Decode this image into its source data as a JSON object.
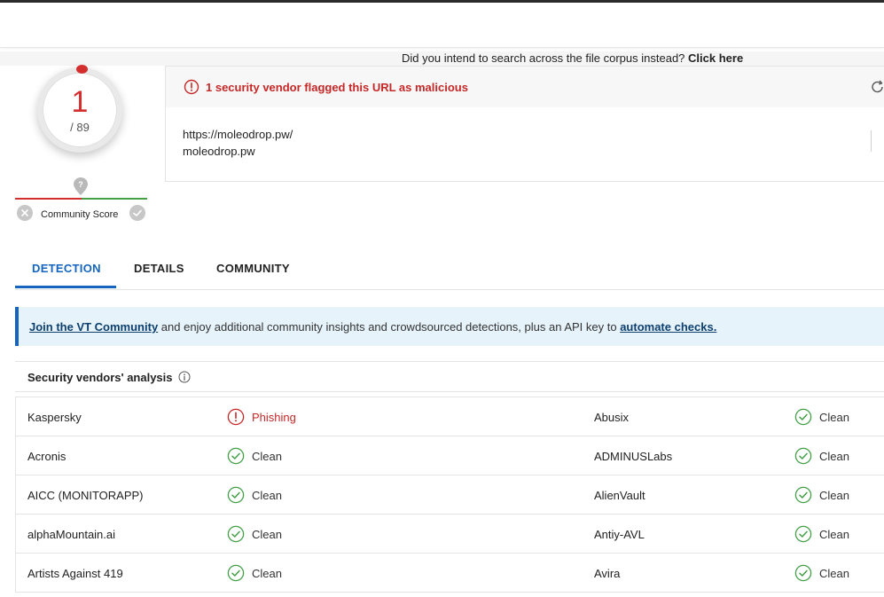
{
  "corpus_hint": {
    "text": "Did you intend to search across the file corpus instead?",
    "link": "Click here"
  },
  "score": {
    "detections": "1",
    "total": "/ 89",
    "color": "#d32f2f"
  },
  "community_score": {
    "label": "Community Score"
  },
  "flag_card": {
    "message": "1 security vendor flagged this URL as malicious",
    "url": "https://moleodrop.pw/",
    "domain": "moleodrop.pw"
  },
  "tabs": [
    {
      "label": "DETECTION",
      "active": true
    },
    {
      "label": "DETAILS",
      "active": false
    },
    {
      "label": "COMMUNITY",
      "active": false
    }
  ],
  "banner": {
    "link1": "Join the VT Community",
    "middle": " and enjoy additional community insights and crowdsourced detections, plus an API key to ",
    "link2": "automate checks."
  },
  "analysis": {
    "title": "Security vendors' analysis"
  },
  "vendors": [
    {
      "left": {
        "name": "Kaspersky",
        "result": "Phishing",
        "status": "malicious"
      },
      "right": {
        "name": "Abusix",
        "result": "Clean",
        "status": "clean"
      }
    },
    {
      "left": {
        "name": "Acronis",
        "result": "Clean",
        "status": "clean"
      },
      "right": {
        "name": "ADMINUSLabs",
        "result": "Clean",
        "status": "clean"
      }
    },
    {
      "left": {
        "name": "AICC (MONITORAPP)",
        "result": "Clean",
        "status": "clean"
      },
      "right": {
        "name": "AlienVault",
        "result": "Clean",
        "status": "clean"
      }
    },
    {
      "left": {
        "name": "alphaMountain.ai",
        "result": "Clean",
        "status": "clean"
      },
      "right": {
        "name": "Antiy-AVL",
        "result": "Clean",
        "status": "clean"
      }
    },
    {
      "left": {
        "name": "Artists Against 419",
        "result": "Clean",
        "status": "clean"
      },
      "right": {
        "name": "Avira",
        "result": "Clean",
        "status": "clean"
      }
    }
  ],
  "colors": {
    "accent": "#1565c0",
    "malicious": "#c62828",
    "clean": "#43a047"
  },
  "icons": {
    "flag": "alert-circle-icon",
    "refresh": "refresh-icon",
    "info": "info-icon",
    "clean": "check-circle-icon",
    "malicious": "alert-circle-icon"
  }
}
